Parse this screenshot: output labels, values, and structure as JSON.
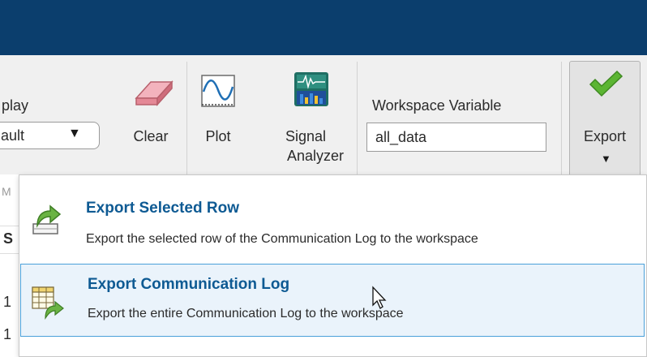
{
  "toolstrip": {
    "display_label": "play",
    "display_value": "ault",
    "clear_label": "Clear",
    "plot_label": "Plot",
    "signal_analyzer_line1": "Signal",
    "signal_analyzer_line2": "Analyzer",
    "workspace_variable_label": "Workspace Variable",
    "workspace_variable_value": "all_data",
    "export_label": "Export",
    "section_hint": "M"
  },
  "table_fragments": {
    "header": "S",
    "row1": "1",
    "row2": "1"
  },
  "export_menu": {
    "items": [
      {
        "title": "Export Selected Row",
        "description": "Export the selected row of the Communication Log to the workspace"
      },
      {
        "title": "Export Communication Log",
        "description": "Export the entire Communication Log to the workspace"
      }
    ]
  },
  "colors": {
    "titlebar": "#0b3e6d",
    "toolstrip": "#f0f0f0",
    "menu_title": "#0e5a93",
    "selected_item_bg": "#eaf3fb",
    "selected_item_border": "#4aa0d9",
    "export_check": "#5cb533"
  }
}
